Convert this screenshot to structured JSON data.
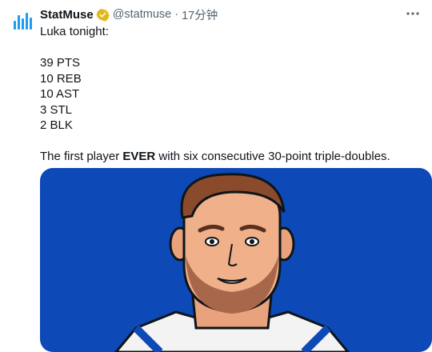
{
  "author": {
    "name": "StatMuse",
    "handle": "@statmuse",
    "separator": "·",
    "time": "17分钟"
  },
  "tweet": {
    "lines": [
      "Luka tonight:",
      "",
      "39 PTS",
      "10 REB",
      "10 AST",
      "3 STL",
      "2 BLK",
      ""
    ],
    "final": {
      "before": "The first player ",
      "bold": "EVER",
      "after": " with six consecutive 30-point triple-doubles."
    }
  },
  "icons": {
    "avatar": "statmuse-logo-icon",
    "verified": "verified-badge-icon",
    "more": "more-options-icon"
  },
  "colors": {
    "media_background": "#0d4ab7",
    "verified": "#e2b719",
    "logo": "#1d9bf0"
  }
}
